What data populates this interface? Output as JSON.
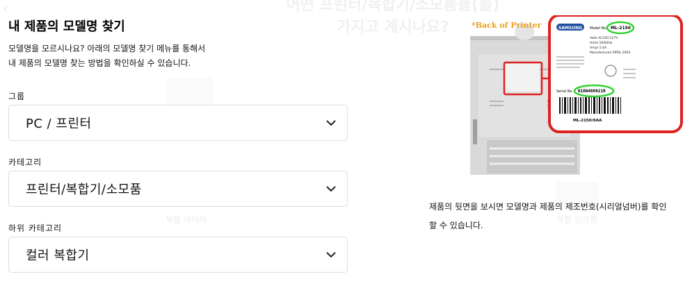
{
  "background": {
    "heading_line1": "어떤 프린터/복합기/소모품을(를)",
    "heading_line2": "가지고 계시나요?",
    "caption_left": "복합 레이저",
    "caption_right": "복합 잉크젯"
  },
  "finder": {
    "title": "내 제품의 모델명 찾기",
    "description_line1": "모델명을 모르시나요? 아래의 모델명 찾기 메뉴를 통해서",
    "description_line2": "내 제품의 모델명 찾는 방법을 확인하실 수 있습니다.",
    "fields": [
      {
        "label": "그룹",
        "value": "PC / 프린터"
      },
      {
        "label": "카테고리",
        "value": "프린터/복합기/소모품"
      },
      {
        "label": "하위 카테고리",
        "value": "컬러 복합기"
      }
    ]
  },
  "example": {
    "photo_heading": "*Back of Printer",
    "label_brand": "SAMSUNG",
    "label_model_label": "Model No.",
    "label_model_value": "ML-2150",
    "label_lines": [
      "Volts  AC100-127V",
      "Hertz  50/60Hz",
      "Amps  5.0A",
      "Manufactured  APRIL 2003"
    ],
    "label_serial_label": "Serial No.",
    "label_serial_value": "B1DW400021R",
    "label_barcode_text": "ML-2150/XAA",
    "caption_line1": "제품의 뒷면을 보시면 모델명과 제품의 제조번호(시리얼넘버)를 확인",
    "caption_line2": "할 수 있습니다."
  },
  "colors": {
    "highlight_red": "#e02020",
    "highlight_green": "#2fd12f"
  }
}
